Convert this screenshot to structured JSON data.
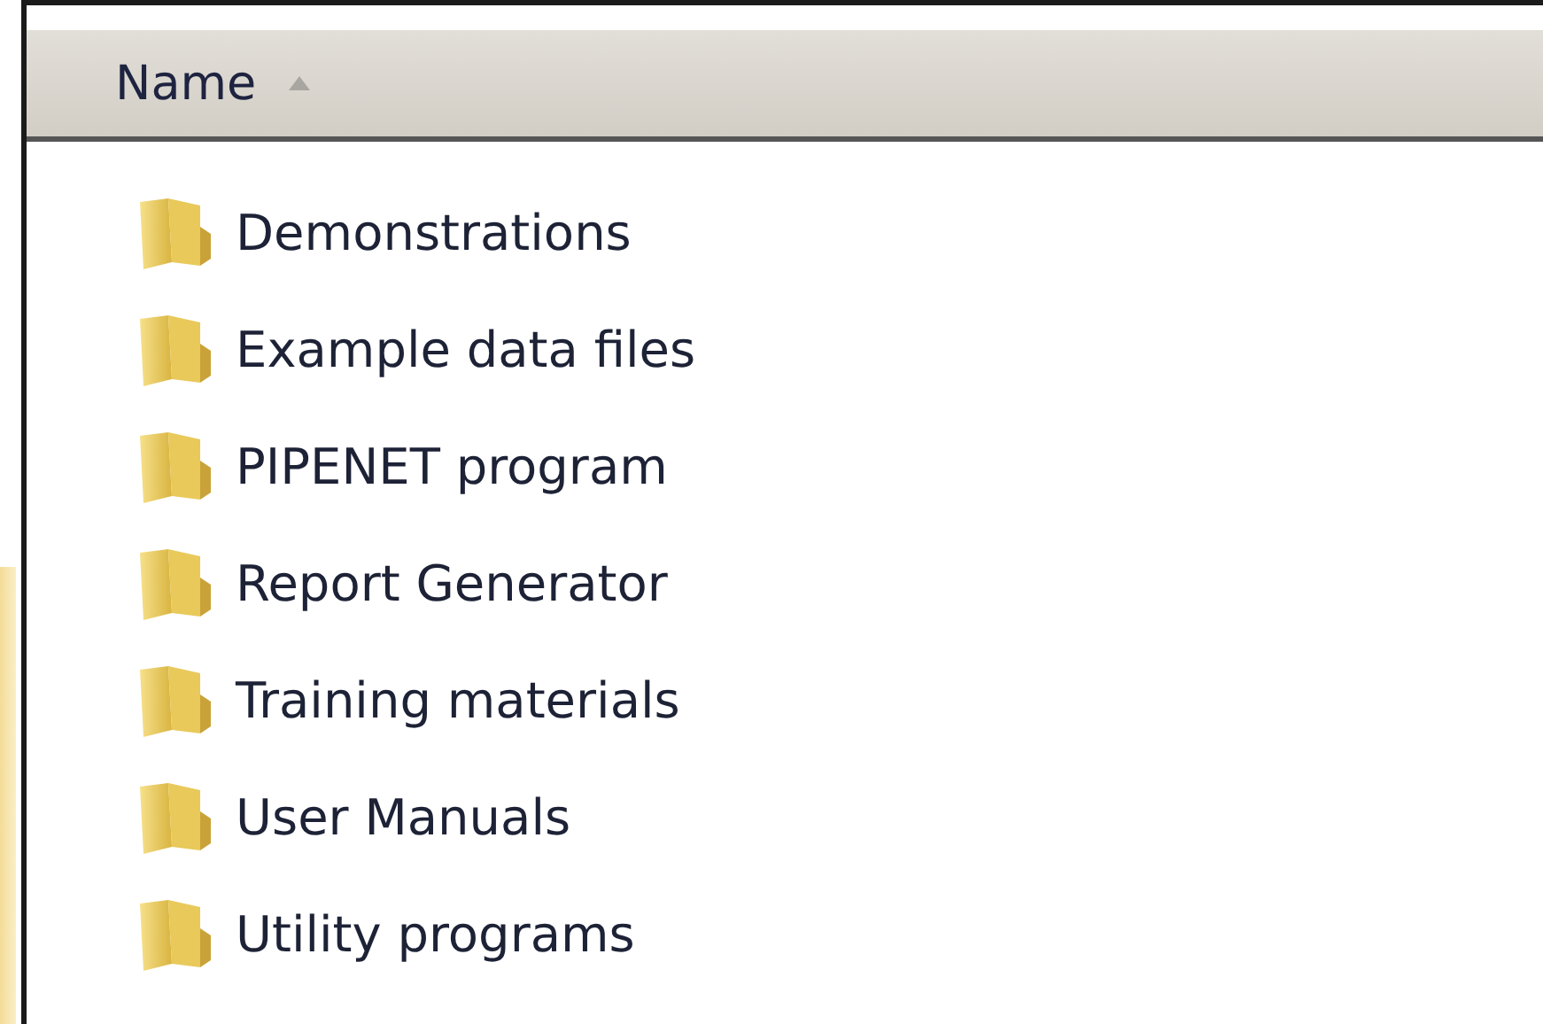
{
  "columns": [
    {
      "label": "Name",
      "sort_ascending": true
    }
  ],
  "items": [
    {
      "name": "Demonstrations"
    },
    {
      "name": "Example data files"
    },
    {
      "name": "PIPENET program"
    },
    {
      "name": "Report Generator"
    },
    {
      "name": "Training materials"
    },
    {
      "name": "User Manuals"
    },
    {
      "name": "Utility programs"
    }
  ]
}
